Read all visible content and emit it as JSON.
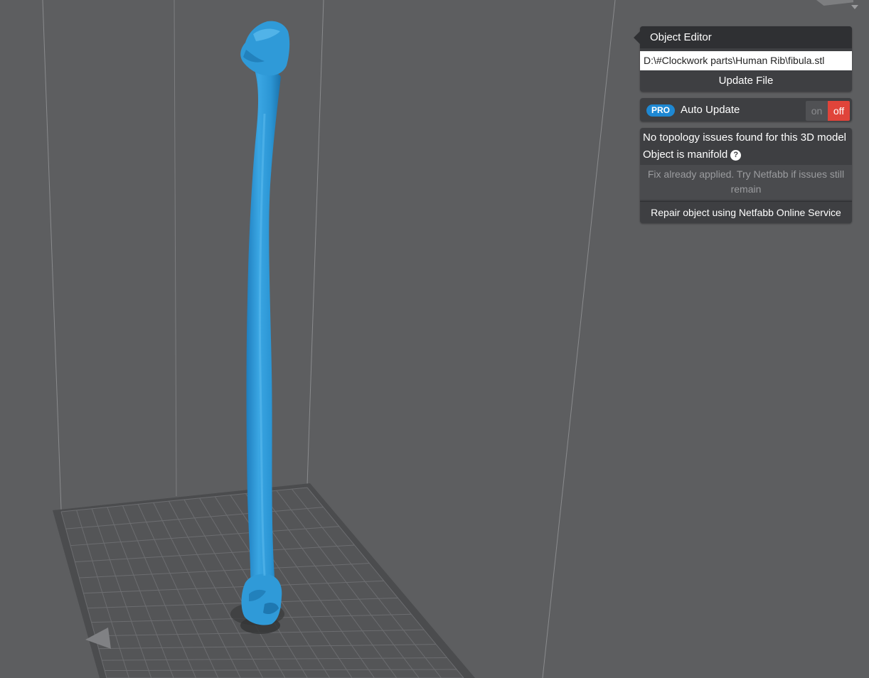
{
  "editor": {
    "title": "Object Editor",
    "file_path": "D:\\#Clockwork parts\\Human Rib\\fibula.stl",
    "update_label": "Update File"
  },
  "auto_update": {
    "badge": "PRO",
    "label": "Auto Update",
    "on_label": "on",
    "off_label": "off",
    "state": "off"
  },
  "topology": {
    "status": "No topology issues found for this 3D model",
    "manifold": "Object is manifold",
    "help_glyph": "?",
    "fix_note": "Fix already applied. Try Netfabb if issues still remain",
    "repair_label": "Repair object using Netfabb Online Service"
  },
  "colors": {
    "background": "#5d5e60",
    "model": "#2f9ad8",
    "panel": "#3e3f42",
    "panel_header": "#2f3033",
    "pro_badge": "#1e88d3",
    "toggle_off": "#e0443a"
  },
  "icons": {
    "help": "question-circle-icon",
    "view_menu": "chevron-down-icon"
  }
}
